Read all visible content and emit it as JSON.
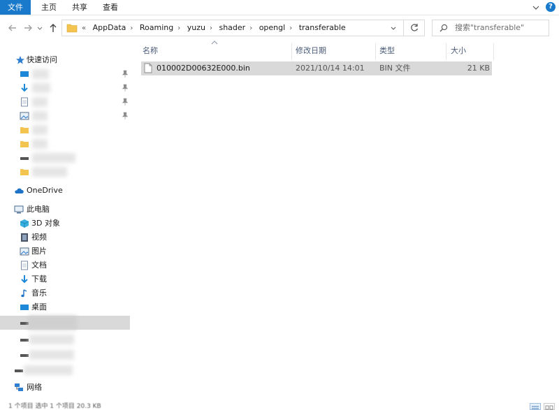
{
  "ribbon": {
    "tabs": [
      "文件",
      "主页",
      "共享",
      "查看"
    ]
  },
  "navigation": {
    "back_icon": "arrow-left-icon",
    "forward_icon": "arrow-right-icon",
    "up_icon": "arrow-up-icon",
    "breadcrumb_prefix": "«",
    "breadcrumb": [
      "AppData",
      "Roaming",
      "yuzu",
      "shader",
      "opengl",
      "transferable"
    ],
    "search_placeholder": "搜索\"transferable\""
  },
  "sidebar": {
    "quick_access": "快速访问",
    "onedrive": "OneDrive",
    "this_pc": "此电脑",
    "pc_items": [
      "3D 对象",
      "视频",
      "图片",
      "文档",
      "下载",
      "音乐",
      "桌面"
    ],
    "network": "网络"
  },
  "filelist": {
    "columns": [
      "名称",
      "修改日期",
      "类型",
      "大小"
    ],
    "rows": [
      {
        "name": "010002D00632E000.bin",
        "modified": "2021/10/14 14:01",
        "type": "BIN 文件",
        "size": "21 KB"
      }
    ]
  },
  "status": {
    "text": "1 个项目    选中 1 个项目  20.3 KB"
  },
  "colors": {
    "accent": "#1979ca",
    "selection": "#d9d9d9",
    "header_text": "#4a5b78"
  }
}
